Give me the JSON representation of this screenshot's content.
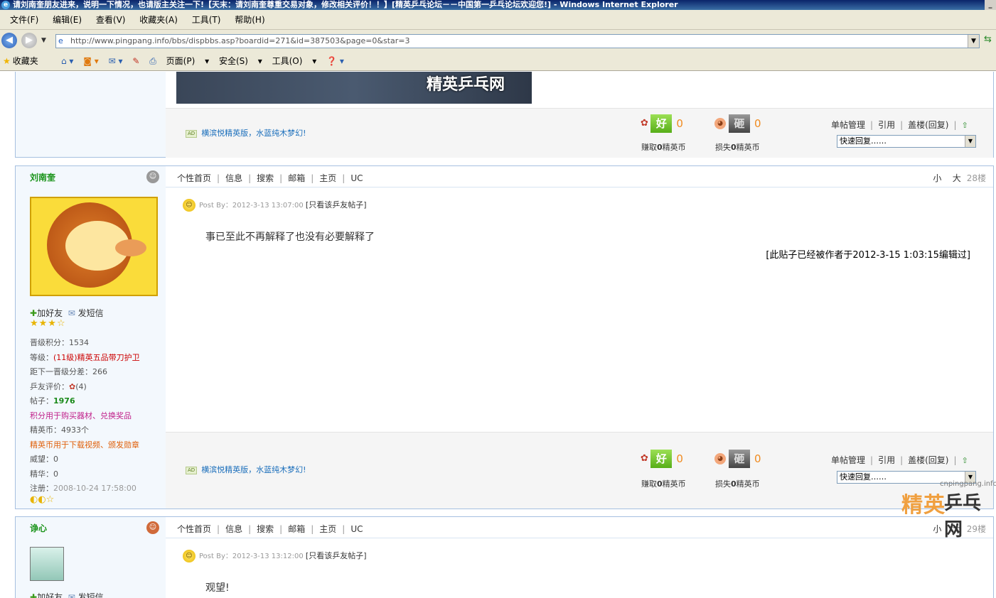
{
  "window": {
    "title": "请刘南奎朋友进来，说明一下情况，也请版主关注一下!【天末：请刘南奎尊重交易对象，修改相关评价！！】[精英乒乓论坛－－中国第一乒乓论坛欢迎您!] - Windows Internet Explorer"
  },
  "menu": [
    "文件(F)",
    "编辑(E)",
    "查看(V)",
    "收藏夹(A)",
    "工具(T)",
    "帮助(H)"
  ],
  "address": {
    "url": "http://www.pingpang.info/bbs/dispbbs.asp?boardid=271&id=387503&page=0&star=3"
  },
  "favbar": {
    "favorites_label": "收藏夹",
    "page_label": "页面(P)",
    "safety_label": "安全(S)",
    "tools_label": "工具(O)"
  },
  "photo_watermark": "精英乒乓网",
  "post_top": {
    "ad_text": "横滨悦精英版，水蓝纯木梦幻!",
    "good_label": "好",
    "good_count": "0",
    "earn_prefix": "赚取",
    "earn_num": "0",
    "earn_suffix": "精英币",
    "bad_label": "砸",
    "bad_count": "0",
    "lose_prefix": "损失",
    "lose_num": "0",
    "lose_suffix": "精英币",
    "actions": [
      "单帖管理",
      "引用",
      "盖楼(回复)"
    ],
    "quick_reply": "快速回复……"
  },
  "post1": {
    "username": "刘南奎",
    "nav": [
      "个性首页",
      "信息",
      "搜索",
      "邮箱",
      "主页",
      "UC"
    ],
    "size_small": "小",
    "size_big": "大",
    "floor": "28楼",
    "add_friend": "加好友",
    "send_msg": "发短信",
    "stars": "★★★☆",
    "info": {
      "score_label": "晋级积分：",
      "score": "1534",
      "level_label": "等级：",
      "level": "(11级)精英五品带刀护卫",
      "next_label": "距下一晋级分差：",
      "next": "266",
      "eval_label": "乒友评价：",
      "eval": "(4)",
      "posts_label": "帖子：",
      "posts": "1976",
      "points_note": "积分用于购买器材、兑换奖品",
      "coins_label": "精英币：",
      "coins": "4933个",
      "coins_note": "精英币用于下载视频、颁发勋章",
      "prestige_label": "威望：",
      "prestige": "0",
      "essence_label": "精华：",
      "essence": "0",
      "reg_label": "注册：",
      "reg": "2008-10-24 17:58:00"
    },
    "moons": "◐◐☆",
    "post_by": "Post By：2012-3-13 13:07:00",
    "only_view": "[只看该乒友帖子]",
    "content": "事已至此不再解释了也没有必要解释了",
    "edit_note": "[此贴子已经被作者于2012-3-15 1:03:15编辑过]",
    "ad_text": "横滨悦精英版，水蓝纯木梦幻!",
    "good_count": "0",
    "bad_count": "0",
    "earn_num": "0",
    "lose_num": "0",
    "quick_reply": "快速回复……"
  },
  "post2": {
    "username": "诤心",
    "nav": [
      "个性首页",
      "信息",
      "搜索",
      "邮箱",
      "主页",
      "UC"
    ],
    "size_small": "小",
    "size_big": "大",
    "floor": "29楼",
    "add_friend": "加好友",
    "send_msg": "发短信",
    "post_by": "Post By：2012-3-13 13:12:00",
    "only_view": "[只看该乒友帖子]",
    "content": "观望!"
  },
  "watermark": {
    "site": "cnpingpang.info",
    "brand1": "精英",
    "brand2": "乒乓网"
  }
}
